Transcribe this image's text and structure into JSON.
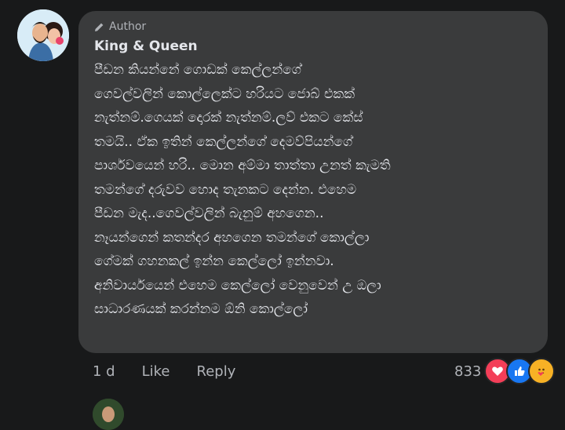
{
  "comment": {
    "author_badge": "Author",
    "author_name": "King & Queen",
    "lines": [
      "පීඩන කියන්නේ ගොඩක් කෙල්ලන්ගේ",
      "ගෙවල්වලින් කොල්ලෙක්ට හරියට ජොබ් එකක්",
      "නැත්නම්.ගෙයක් දොරක් නැත්නම්.ලව් එකට කේස්",
      "තමයි.. ඒක ඉතින් කෙල්ලන්ගේ දෙමව්පියන්ගේ",
      "පාර්ශවයෙන් හරි.. මොන අම්මා තාත්තා උනත් කැමති",
      "තමන්ගේ දරුවව හොද තැනකට දෙන්න. එහෙම",
      "පීඩන මැද..ගෙවල්වලින් බැනුම් අහගෙන..",
      "නෑයන්ගෙන් කතන්දර අහගෙන තමන්ගේ කොල්ලා",
      "ගේමක් ගහනකල් ඉන්න කෙල්ලෝ ඉන්නවා.",
      "අනිවාර්යයෙන් එහෙම කෙල්ලෝ වෙනුවෙන් උ ඔලා",
      "සාධාරණයක් කරන්නම ඕනි කොල්ලෝ"
    ]
  },
  "actions": {
    "time": "1 d",
    "like": "Like",
    "reply": "Reply"
  },
  "reactions": {
    "count": "833",
    "icons": [
      "love-icon",
      "like-icon",
      "care-icon"
    ],
    "colors": {
      "love": "#f33e58",
      "like": "#1877f2",
      "care": "#f7b125"
    }
  }
}
